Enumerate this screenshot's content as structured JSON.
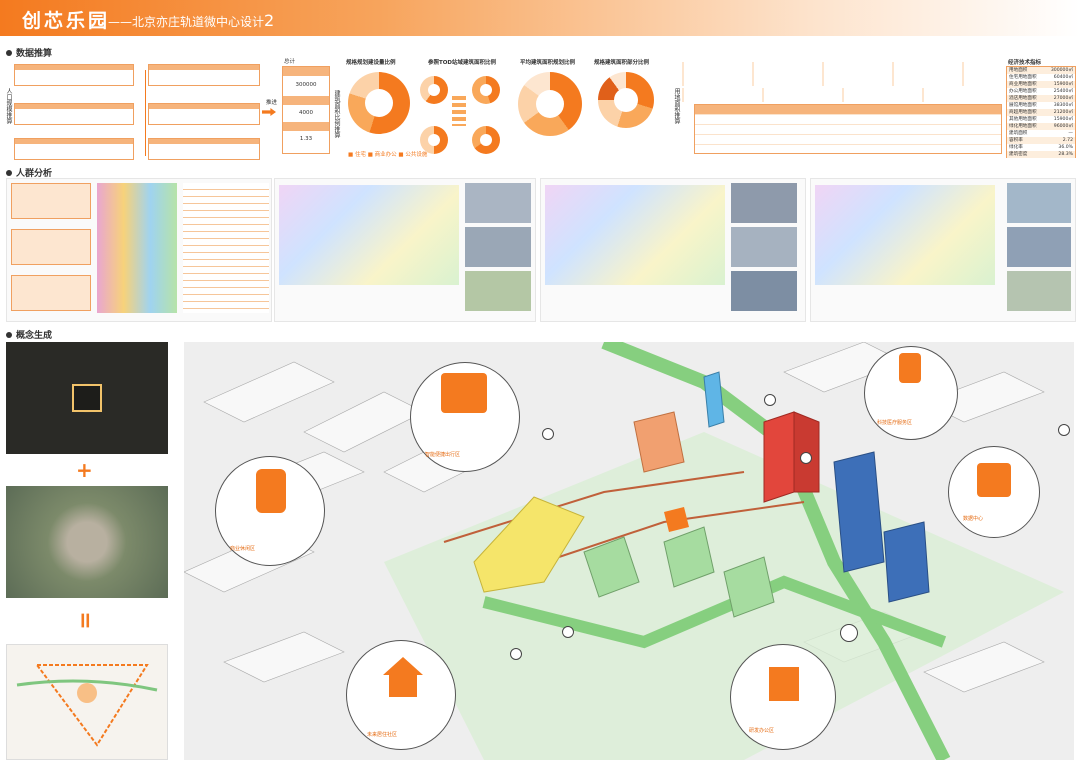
{
  "header": {
    "title": "创芯乐园",
    "subtitle_prefix": "——北京亦庄轨道微中心设计",
    "subtitle_num": "2"
  },
  "sections": {
    "data": "数据推算",
    "crowd": "人群分析",
    "concept": "概念生成"
  },
  "data_section": {
    "side_label": "人口规模推算",
    "summary_label": "总计",
    "summary_values": [
      "300000",
      "4000",
      "1.33"
    ],
    "arrow_label": "推进",
    "chart_titles": [
      "规格规划建设量比例",
      "参照TOD站域建筑面积比例",
      "平均建筑面积规划比例",
      "规格建筑面积部分比例"
    ],
    "ratio_label": "建筑面积比例推算",
    "legend": [
      "住宅",
      "商业办公",
      "公共设施"
    ],
    "right_label": "用地面积推算"
  },
  "econ_table": {
    "title": "经济技术指标",
    "rows": [
      [
        "用地面积",
        "300000㎡"
      ],
      [
        "住宅用地面积",
        "60400㎡"
      ],
      [
        "商业用地面积",
        "15900㎡"
      ],
      [
        "办公用地面积",
        "25400㎡"
      ],
      [
        "酒店用地面积",
        "27000㎡"
      ],
      [
        "展馆用地面积",
        "38300㎡"
      ],
      [
        "商超用地面积",
        "21200㎡"
      ],
      [
        "其他用地面积",
        "15900㎡"
      ],
      [
        "绿化用地面积",
        "96000㎡"
      ],
      [
        "建筑面积",
        "—"
      ],
      [
        "容积率",
        "2.72"
      ],
      [
        "绿化率",
        "36.0%"
      ],
      [
        "建筑密度",
        "28.3%"
      ]
    ]
  },
  "concept": {
    "plus": "+",
    "equals": "="
  },
  "captions": [
    "智能便捷出行区",
    "科技医疗服务区",
    "数据中心",
    "未来居住社区",
    "商业休闲区",
    "研发办公区"
  ]
}
